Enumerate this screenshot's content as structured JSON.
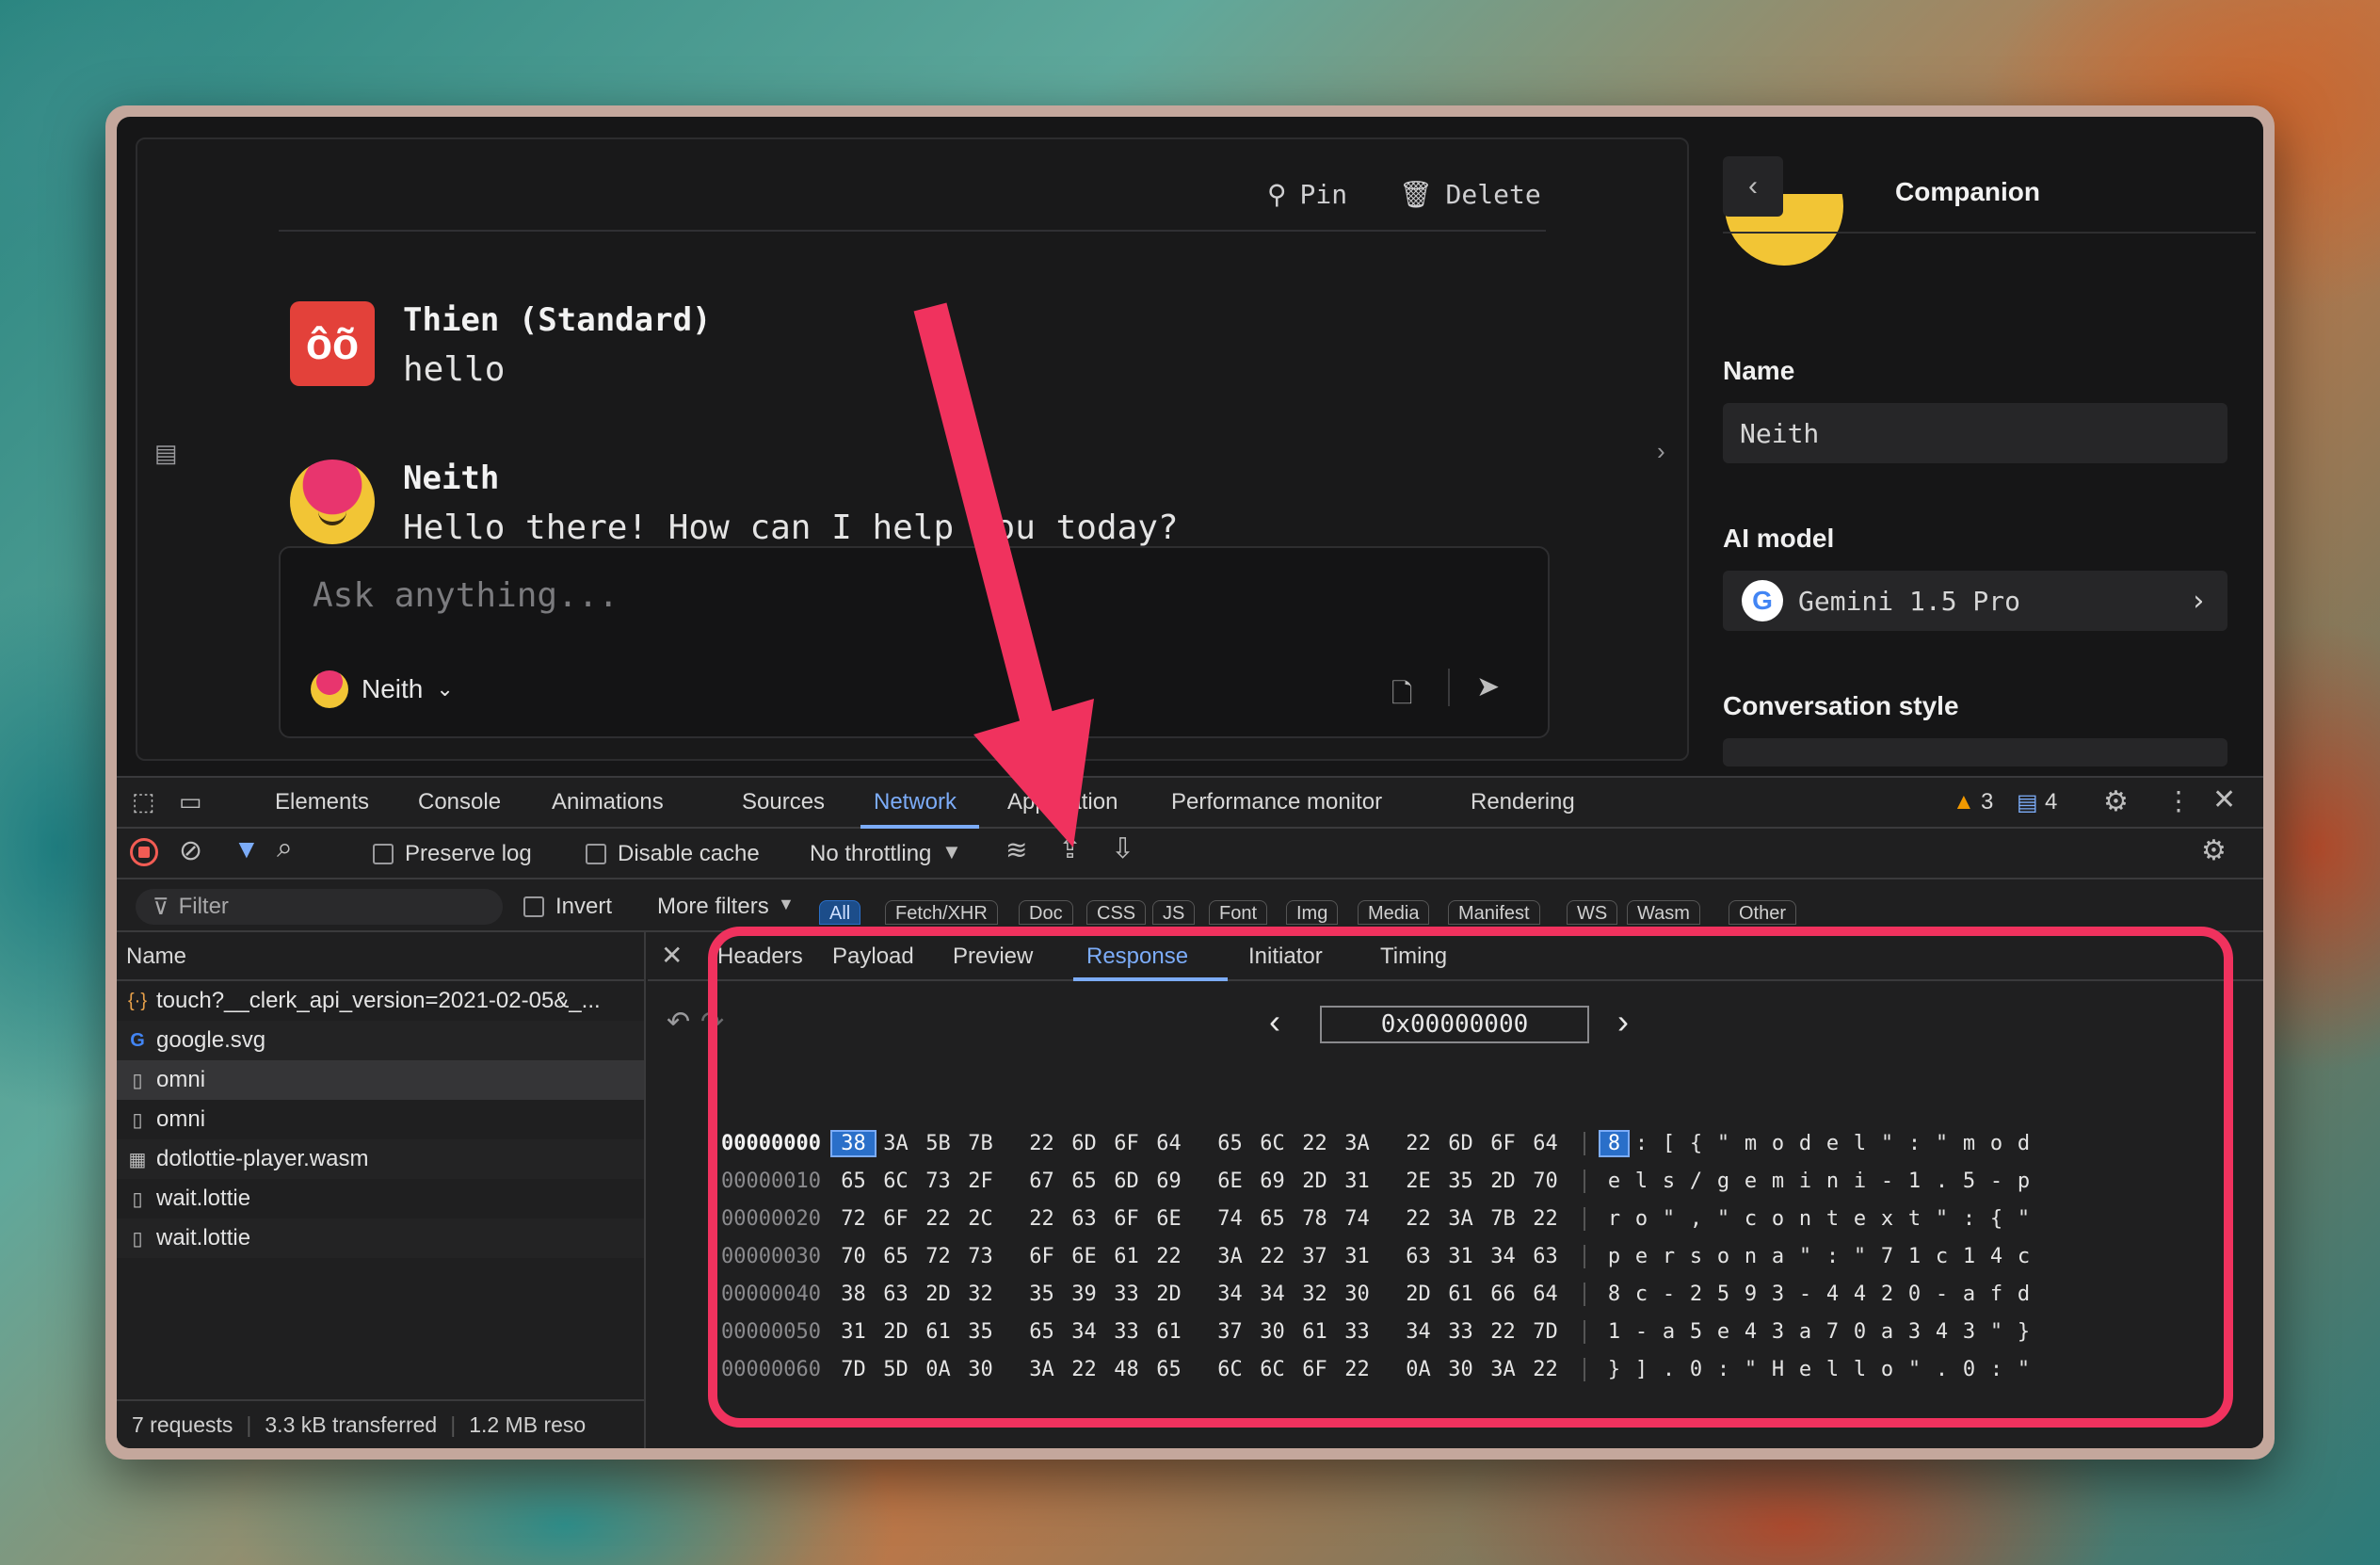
{
  "chat": {
    "pin_label": "Pin",
    "delete_label": "Delete",
    "messages": [
      {
        "avatar_text": "ôõ",
        "name": "Thien (Standard)",
        "text": "hello"
      },
      {
        "name": "Neith",
        "text": "Hello there! How can I help you today?"
      }
    ],
    "input_placeholder": "Ask anything...",
    "persona_label": "Neith"
  },
  "companion": {
    "title": "Companion",
    "name_label": "Name",
    "name_value": "Neith",
    "model_label": "AI model",
    "model_value": "Gemini 1.5 Pro",
    "style_label": "Conversation style"
  },
  "devtools": {
    "tabs": [
      "Elements",
      "Console",
      "Animations",
      "Sources",
      "Network",
      "Application",
      "Performance monitor",
      "Rendering"
    ],
    "active_tab": "Network",
    "warnings": "3",
    "messages": "4",
    "preserve_log": "Preserve log",
    "disable_cache": "Disable cache",
    "throttling": "No throttling",
    "filter_placeholder": "Filter",
    "invert": "Invert",
    "more_filters": "More filters",
    "filter_chips": [
      "All",
      "Fetch/XHR",
      "Doc",
      "CSS",
      "JS",
      "Font",
      "Img",
      "Media",
      "Manifest",
      "WS",
      "Wasm",
      "Other"
    ],
    "name_header": "Name",
    "requests": [
      {
        "icon": "{·}",
        "name": "touch?__clerk_api_version=2021-02-05&_..."
      },
      {
        "icon": "G",
        "name": "google.svg"
      },
      {
        "icon": "▯",
        "name": "omni"
      },
      {
        "icon": "▯",
        "name": "omni"
      },
      {
        "icon": "▦",
        "name": "dotlottie-player.wasm"
      },
      {
        "icon": "▯",
        "name": "wait.lottie"
      },
      {
        "icon": "▯",
        "name": "wait.lottie"
      }
    ],
    "status": {
      "requests": "7 requests",
      "transferred": "3.3 kB transferred",
      "resources": "1.2 MB reso"
    },
    "detail_tabs": [
      "Headers",
      "Payload",
      "Preview",
      "Response",
      "Initiator",
      "Timing"
    ],
    "active_detail_tab": "Response",
    "hex_address": "0x00000000",
    "hex_rows": [
      {
        "offset": "00000000",
        "bytes": [
          "38",
          "3A",
          "5B",
          "7B",
          "22",
          "6D",
          "6F",
          "64",
          "65",
          "6C",
          "22",
          "3A",
          "22",
          "6D",
          "6F",
          "64"
        ],
        "ascii": [
          "8",
          ":",
          "[",
          "{",
          "\"",
          "m",
          "o",
          "d",
          "e",
          "l",
          "\"",
          ":",
          "\"",
          "m",
          "o",
          "d"
        ]
      },
      {
        "offset": "00000010",
        "bytes": [
          "65",
          "6C",
          "73",
          "2F",
          "67",
          "65",
          "6D",
          "69",
          "6E",
          "69",
          "2D",
          "31",
          "2E",
          "35",
          "2D",
          "70"
        ],
        "ascii": [
          "e",
          "l",
          "s",
          "/",
          "g",
          "e",
          "m",
          "i",
          "n",
          "i",
          "-",
          "1",
          ".",
          "5",
          "-",
          "p"
        ]
      },
      {
        "offset": "00000020",
        "bytes": [
          "72",
          "6F",
          "22",
          "2C",
          "22",
          "63",
          "6F",
          "6E",
          "74",
          "65",
          "78",
          "74",
          "22",
          "3A",
          "7B",
          "22"
        ],
        "ascii": [
          "r",
          "o",
          "\"",
          ",",
          "\"",
          "c",
          "o",
          "n",
          "t",
          "e",
          "x",
          "t",
          "\"",
          ":",
          "{",
          "\""
        ]
      },
      {
        "offset": "00000030",
        "bytes": [
          "70",
          "65",
          "72",
          "73",
          "6F",
          "6E",
          "61",
          "22",
          "3A",
          "22",
          "37",
          "31",
          "63",
          "31",
          "34",
          "63"
        ],
        "ascii": [
          "p",
          "e",
          "r",
          "s",
          "o",
          "n",
          "a",
          "\"",
          ":",
          "\"",
          "7",
          "1",
          "c",
          "1",
          "4",
          "c"
        ]
      },
      {
        "offset": "00000040",
        "bytes": [
          "38",
          "63",
          "2D",
          "32",
          "35",
          "39",
          "33",
          "2D",
          "34",
          "34",
          "32",
          "30",
          "2D",
          "61",
          "66",
          "64"
        ],
        "ascii": [
          "8",
          "c",
          "-",
          "2",
          "5",
          "9",
          "3",
          "-",
          "4",
          "4",
          "2",
          "0",
          "-",
          "a",
          "f",
          "d"
        ]
      },
      {
        "offset": "00000050",
        "bytes": [
          "31",
          "2D",
          "61",
          "35",
          "65",
          "34",
          "33",
          "61",
          "37",
          "30",
          "61",
          "33",
          "34",
          "33",
          "22",
          "7D"
        ],
        "ascii": [
          "1",
          "-",
          "a",
          "5",
          "e",
          "4",
          "3",
          "a",
          "7",
          "0",
          "a",
          "3",
          "4",
          "3",
          "\"",
          "}"
        ]
      },
      {
        "offset": "00000060",
        "bytes": [
          "7D",
          "5D",
          "0A",
          "30",
          "3A",
          "22",
          "48",
          "65",
          "6C",
          "6C",
          "6F",
          "22",
          "0A",
          "30",
          "3A",
          "22"
        ],
        "ascii": [
          "}",
          "]",
          ".",
          "0",
          ":",
          "\"",
          "H",
          "e",
          "l",
          "l",
          "o",
          "\"",
          ".",
          "0",
          ":",
          "\""
        ]
      }
    ]
  },
  "colors": {
    "accent": "#7cacf8",
    "highlight": "#f0325e",
    "warning": "#f29900"
  }
}
